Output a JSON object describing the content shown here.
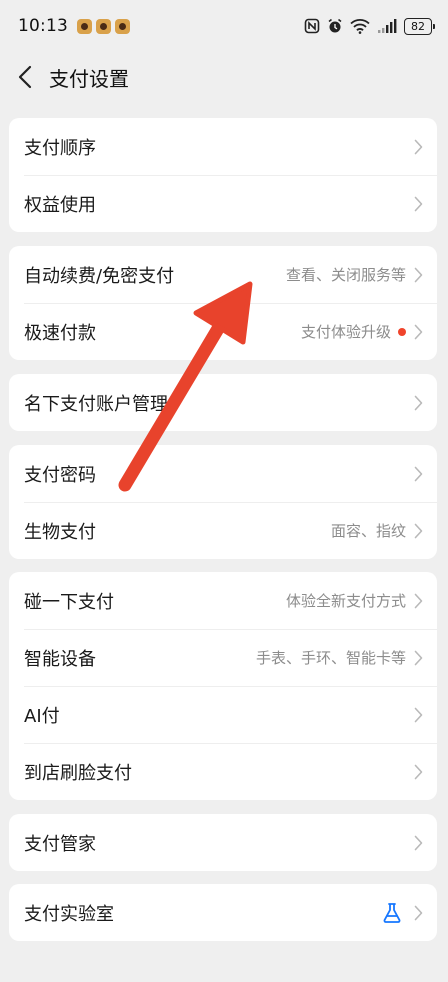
{
  "status_bar": {
    "time": "10:13",
    "battery": "82",
    "icons": [
      "app-icon",
      "app-icon",
      "app-icon",
      "nfc-icon",
      "alarm-icon",
      "wifi-icon",
      "signal-icon",
      "battery-icon"
    ]
  },
  "header": {
    "title": "支付设置",
    "back_icon": "chevron-left-icon"
  },
  "groups": [
    {
      "items": [
        {
          "label": "支付顺序",
          "hint": ""
        },
        {
          "label": "权益使用",
          "hint": ""
        }
      ]
    },
    {
      "items": [
        {
          "label": "自动续费/免密支付",
          "hint": "查看、关闭服务等"
        },
        {
          "label": "极速付款",
          "hint": "支付体验升级",
          "badge": "red-dot"
        }
      ]
    },
    {
      "items": [
        {
          "label": "名下支付账户管理",
          "hint": ""
        }
      ]
    },
    {
      "items": [
        {
          "label": "支付密码",
          "hint": ""
        },
        {
          "label": "生物支付",
          "hint": "面容、指纹"
        }
      ]
    },
    {
      "items": [
        {
          "label": "碰一下支付",
          "hint": "体验全新支付方式"
        },
        {
          "label": "智能设备",
          "hint": "手表、手环、智能卡等"
        },
        {
          "label": "AI付",
          "hint": ""
        },
        {
          "label": "到店刷脸支付",
          "hint": ""
        }
      ]
    },
    {
      "items": [
        {
          "label": "支付管家",
          "hint": ""
        }
      ]
    },
    {
      "items": [
        {
          "label": "支付实验室",
          "hint": "",
          "icon": "flask-icon"
        }
      ]
    }
  ],
  "colors": {
    "background": "#efefef",
    "card": "#ffffff",
    "hint_text": "#8c8c8c",
    "badge_dot": "#f0442b",
    "annotation_arrow": "#e8432c",
    "flask_icon": "#1677ff"
  }
}
